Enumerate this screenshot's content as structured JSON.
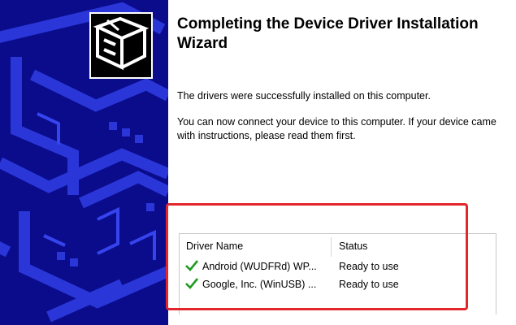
{
  "wizard": {
    "title": "Completing the Device Driver Installation Wizard",
    "message_success": "The drivers were successfully installed on this computer.",
    "message_connect": "You can now connect your device to this computer. If your device came with instructions, please read them first."
  },
  "driver_list": {
    "columns": {
      "name": "Driver Name",
      "status": "Status"
    },
    "rows": [
      {
        "name": "Android (WUDFRd) WP...",
        "status": "Ready to use",
        "icon": "checkmark-icon"
      },
      {
        "name": "Google, Inc. (WinUSB) ...",
        "status": "Ready to use",
        "icon": "checkmark-icon"
      }
    ]
  },
  "colors": {
    "banner": "#0a0c8c",
    "highlight": "#e3262b",
    "check": "#1e9a1e"
  }
}
